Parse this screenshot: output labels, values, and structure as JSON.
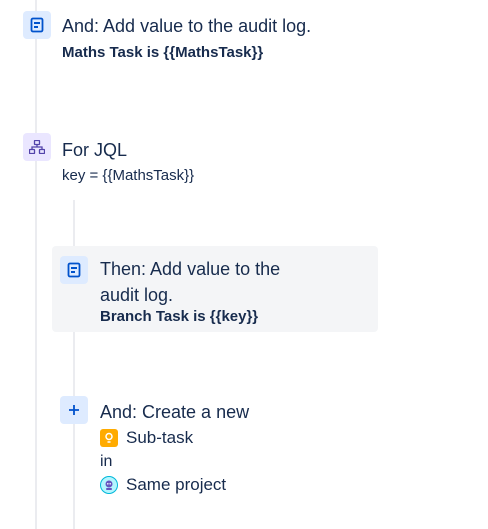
{
  "step1": {
    "title": "And: Add value to the audit log.",
    "detail": "Maths Task is {{MathsTask}}",
    "icon": "audit-log-icon"
  },
  "branch": {
    "title": "For JQL",
    "detail": "key = {{MathsTask}}",
    "icon": "branch-icon"
  },
  "then_step": {
    "title_line1": "Then: Add value to the",
    "title_line2": "audit log.",
    "detail": "Branch Task is {{key}}",
    "icon": "audit-log-icon"
  },
  "create_step": {
    "title": "And: Create a new",
    "issue_type": "Sub-task",
    "in_label": "in",
    "project": "Same project",
    "icon": "plus-icon"
  },
  "colors": {
    "accent_blue": "#0052CC",
    "tile_blue": "#DEEBFF",
    "tile_purple": "#EAE6FF",
    "text": "#172B4D",
    "line": "#EBECF0",
    "card_bg": "#F4F5F7",
    "subtask_orange": "#FFAB00"
  }
}
